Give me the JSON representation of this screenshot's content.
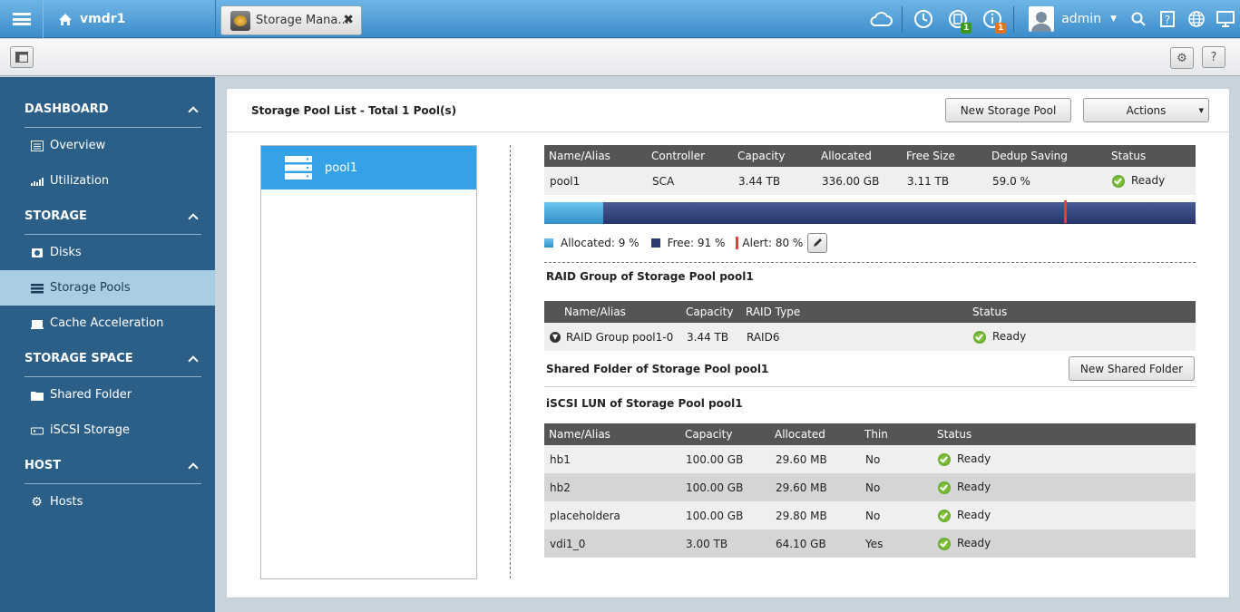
{
  "topbar": {
    "host": "vmdr1",
    "tab_label": "Storage Mana...",
    "user": "admin",
    "badge_backup": "1",
    "badge_info": "1",
    "colors": {
      "badge_green": "#3a9a1c",
      "badge_orange": "#e8731c"
    }
  },
  "sidebar": {
    "sections": [
      {
        "title": "DASHBOARD",
        "items": [
          {
            "label": "Overview",
            "icon": "overview-icon"
          },
          {
            "label": "Utilization",
            "icon": "chart-icon"
          }
        ]
      },
      {
        "title": "STORAGE",
        "items": [
          {
            "label": "Disks",
            "icon": "disk-icon"
          },
          {
            "label": "Storage Pools",
            "icon": "pool-icon"
          },
          {
            "label": "Cache Acceleration",
            "icon": "cache-icon"
          }
        ]
      },
      {
        "title": "STORAGE SPACE",
        "items": [
          {
            "label": "Shared Folder",
            "icon": "folder-icon"
          },
          {
            "label": "iSCSI Storage",
            "icon": "iscsi-icon"
          }
        ]
      },
      {
        "title": "HOST",
        "items": [
          {
            "label": "Hosts",
            "icon": "gear-icon"
          }
        ]
      }
    ],
    "active": "Storage Pools"
  },
  "main": {
    "title": "Storage Pool List - Total 1 Pool(s)",
    "new_pool_btn": "New Storage Pool",
    "actions_btn": "Actions",
    "pool_list": [
      "pool1"
    ],
    "pool_table": {
      "headers": [
        "Name/Alias",
        "Controller",
        "Capacity",
        "Allocated",
        "Free Size",
        "Dedup Saving",
        "Status"
      ],
      "row": [
        "pool1",
        "SCA",
        "3.44 TB",
        "336.00 GB",
        "3.11 TB",
        "59.0 %",
        "Ready"
      ]
    },
    "usage": {
      "allocated_pct": 9,
      "free_pct": 91,
      "alert_pct": 80,
      "allocated_label": "Allocated: 9 %",
      "free_label": "Free: 91 %",
      "alert_label": "Alert: 80 %"
    },
    "raid_title": "RAID Group of Storage Pool pool1",
    "raid_table": {
      "headers": [
        "Name/Alias",
        "Capacity",
        "RAID Type",
        "Status"
      ],
      "row": [
        "RAID Group pool1-0",
        "3.44 TB",
        "RAID6",
        "Ready"
      ]
    },
    "shared_title": "Shared Folder of Storage Pool pool1",
    "new_shared_btn": "New Shared Folder",
    "iscsi_title": "iSCSI LUN of Storage Pool pool1",
    "iscsi_table": {
      "headers": [
        "Name/Alias",
        "Capacity",
        "Allocated",
        "Thin",
        "Status"
      ],
      "rows": [
        [
          "hb1",
          "100.00 GB",
          "29.60 MB",
          "No",
          "Ready"
        ],
        [
          "hb2",
          "100.00 GB",
          "29.60 MB",
          "No",
          "Ready"
        ],
        [
          "placeholdera",
          "100.00 GB",
          "29.80 MB",
          "No",
          "Ready"
        ],
        [
          "vdi1_0",
          "3.00 TB",
          "64.10 GB",
          "Yes",
          "Ready"
        ]
      ]
    }
  }
}
